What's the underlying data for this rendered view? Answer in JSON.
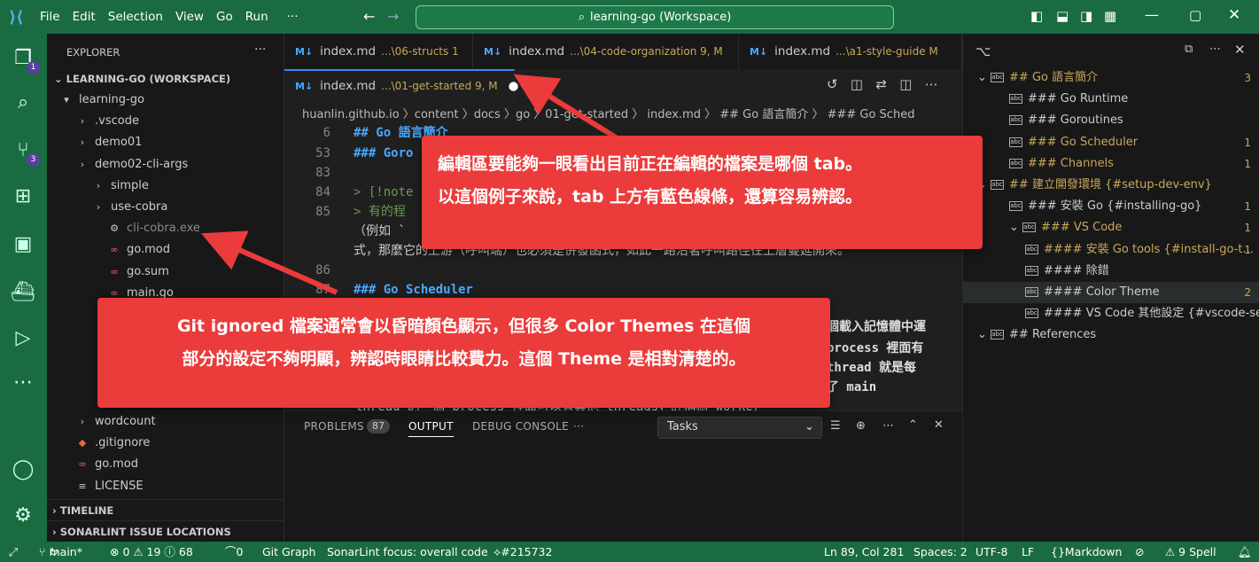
{
  "titlebar": {
    "menu": [
      "File",
      "Edit",
      "Selection",
      "View",
      "Go",
      "Run",
      "···"
    ],
    "search": "learning-go (Workspace)"
  },
  "activity": {
    "explorer_badge": "1",
    "scm_badge": "3"
  },
  "sidebar": {
    "header": "EXPLORER",
    "more": "···",
    "workspace": "LEARNING-GO (WORKSPACE)",
    "items": [
      {
        "label": "learning-go",
        "icon": "folder-open-icon"
      },
      {
        "label": ".vscode",
        "icon": "folder-icon"
      },
      {
        "label": "demo01",
        "icon": "folder-icon"
      },
      {
        "label": "demo02-cli-args",
        "icon": "folder-icon"
      },
      {
        "label": "simple",
        "icon": "folder-icon"
      },
      {
        "label": "use-cobra",
        "icon": "folder-icon"
      },
      {
        "label": "cli-cobra.exe",
        "icon": "exe-file-icon",
        "ignored": true
      },
      {
        "label": "go.mod",
        "icon": "go-file-icon"
      },
      {
        "label": "go.sum",
        "icon": "go-file-icon"
      },
      {
        "label": "main.go",
        "icon": "go-file-icon"
      }
    ],
    "items_bottom": [
      {
        "label": "wordcount",
        "icon": "folder-icon"
      },
      {
        "label": ".gitignore",
        "icon": "git-file-icon"
      },
      {
        "label": "go.mod",
        "icon": "go-file-icon"
      },
      {
        "label": "LICENSE",
        "icon": "license-file-icon"
      }
    ],
    "sections": [
      "TIMELINE",
      "SONARLINT ISSUE LOCATIONS"
    ]
  },
  "tabs": [
    {
      "label": "index.md",
      "sub": "...\\06-structs 1"
    },
    {
      "label": "index.md",
      "sub": "...\\04-code-organization 9, M"
    },
    {
      "label": "index.md",
      "sub": "...\\a1-style-guide   M"
    },
    {
      "label": "index.md",
      "sub": "...\\01-get-started 9, M"
    }
  ],
  "breadcrumb": "huanlin.github.io 〉content 〉docs 〉go 〉01-get-started 〉 index.md 〉 ## Go 語言簡介 〉 ### Go Sched",
  "code": [
    {
      "n": "6",
      "t": "## Go 語言簡介",
      "c": "#4aa8ff",
      "b": true
    },
    {
      "n": "53",
      "t": "### Goro",
      "c": "#4aa8ff",
      "b": true
    },
    {
      "n": "83",
      "t": "",
      "c": "#ccc"
    },
    {
      "n": "84",
      "t": "> [!note",
      "c": "#6a9955"
    },
    {
      "n": "85",
      "t": "> 有的程",
      "c": "#6a9955"
    },
    {
      "n": "",
      "t": "（例如 `",
      "c": "#ccc"
    },
    {
      "n": "",
      "t": "式，那麼它的上游（呼叫端）也必須是併發函式，如此一路沿著呼叫路徑往上層蔓延開來。",
      "c": "#ccc"
    },
    {
      "n": "86",
      "t": "",
      "c": "#ccc"
    },
    {
      "n": "87",
      "t": "### Go Scheduler",
      "c": "#4aa8ff",
      "b": true
    }
  ],
  "code_right": [
    {
      "t": "個載入記憶體中運"
    },
    {
      "t": "process 裡面有"
    },
    {
      "t": "thread 就是每"
    },
    {
      "t": "了 main"
    }
  ],
  "code_tail": "thread 的一個 process 裡面可以有其他 threads，許稱為 worker",
  "panel": {
    "tabs": [
      "PROBLEMS",
      "OUTPUT",
      "DEBUG CONSOLE",
      "···"
    ],
    "problems_count": "87",
    "select": "Tasks"
  },
  "outline": {
    "items": [
      {
        "label": "## Go 語言簡介",
        "count": "3",
        "color": "#c9a85a",
        "depth": 0
      },
      {
        "label": "### Go Runtime",
        "count": "",
        "color": "#ccc",
        "depth": 1
      },
      {
        "label": "### Goroutines",
        "count": "",
        "color": "#ccc",
        "depth": 1
      },
      {
        "label": "### Go Scheduler",
        "count": "1",
        "color": "#c9a85a",
        "depth": 1
      },
      {
        "label": "### Channels",
        "count": "1",
        "color": "#c9a85a",
        "depth": 1
      },
      {
        "label": "## 建立開發環境 {#setup-dev-env}",
        "count": "",
        "color": "#c9a85a",
        "depth": 0
      },
      {
        "label": "### 安裝 Go {#installing-go}",
        "count": "1",
        "color": "#ccc",
        "depth": 1
      },
      {
        "label": "### VS Code",
        "count": "1",
        "color": "#c9a85a",
        "depth": 1
      },
      {
        "label": "#### 安裝 Go tools {#install-go-t...",
        "count": "1",
        "color": "#c9a85a",
        "depth": 2
      },
      {
        "label": "#### 除錯",
        "count": "",
        "color": "#ccc",
        "depth": 2
      },
      {
        "label": "#### Color Theme",
        "count": "2",
        "color": "#ccc",
        "depth": 2
      },
      {
        "label": "#### VS Code 其他設定 {#vscode-se...",
        "count": "",
        "color": "#ccc",
        "depth": 2
      },
      {
        "label": "## References",
        "count": "",
        "color": "#ccc",
        "depth": 0
      }
    ]
  },
  "status": {
    "branch": "main*",
    "errors": "⊗ 0 ⚠ 19 ⓘ 68",
    "ports": "0",
    "gitgraph": "Git Graph",
    "sonar": "SonarLint focus: overall code",
    "pr": "#215732",
    "pos": "Ln 89, Col 281",
    "spaces": "Spaces: 2",
    "enc": "UTF-8",
    "eol": "LF",
    "lang": "Markdown",
    "spell": "⚠ 9 Spell"
  },
  "callouts": {
    "top": [
      "編輯區要能夠一眼看出目前正在編輯的檔案是哪個 tab。",
      "以這個例子來說，tab 上方有藍色線條，還算容易辨認。"
    ],
    "bottom": [
      "Git ignored 檔案通常會以昏暗顏色顯示，但很多 Color Themes 在這個",
      "部分的設定不夠明顯，辨認時眼睛比較費力。這個 Theme 是相對清楚的。"
    ]
  },
  "colors": {
    "titlebar": "#1a6b3f",
    "accent": "#3b8eea",
    "callout": "#ec3b3b",
    "heading": "#4aa8ff",
    "warning": "#c9a85a"
  }
}
